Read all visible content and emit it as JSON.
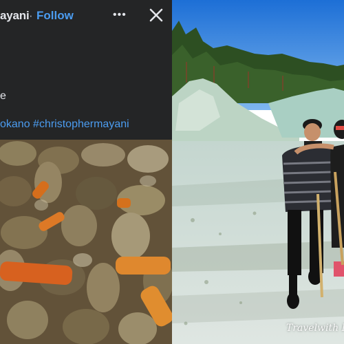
{
  "post": {
    "author_name": "ayani",
    "separator": "·",
    "follow_label": "Follow",
    "more_icon": "more-horizontal-icon",
    "close_icon": "close-icon",
    "caption_fragment": "e",
    "hashtags": "okano #christophermayani"
  },
  "food_photo": {
    "subject": "stew with meat chunks and carrot slices"
  },
  "travel_photo": {
    "watermark": "Travelwith Ka"
  },
  "colors": {
    "fb_dark_bg": "#242526",
    "fb_text": "#e4e6eb",
    "fb_link": "#4b9cf0",
    "sky": "#2f7bdc"
  }
}
